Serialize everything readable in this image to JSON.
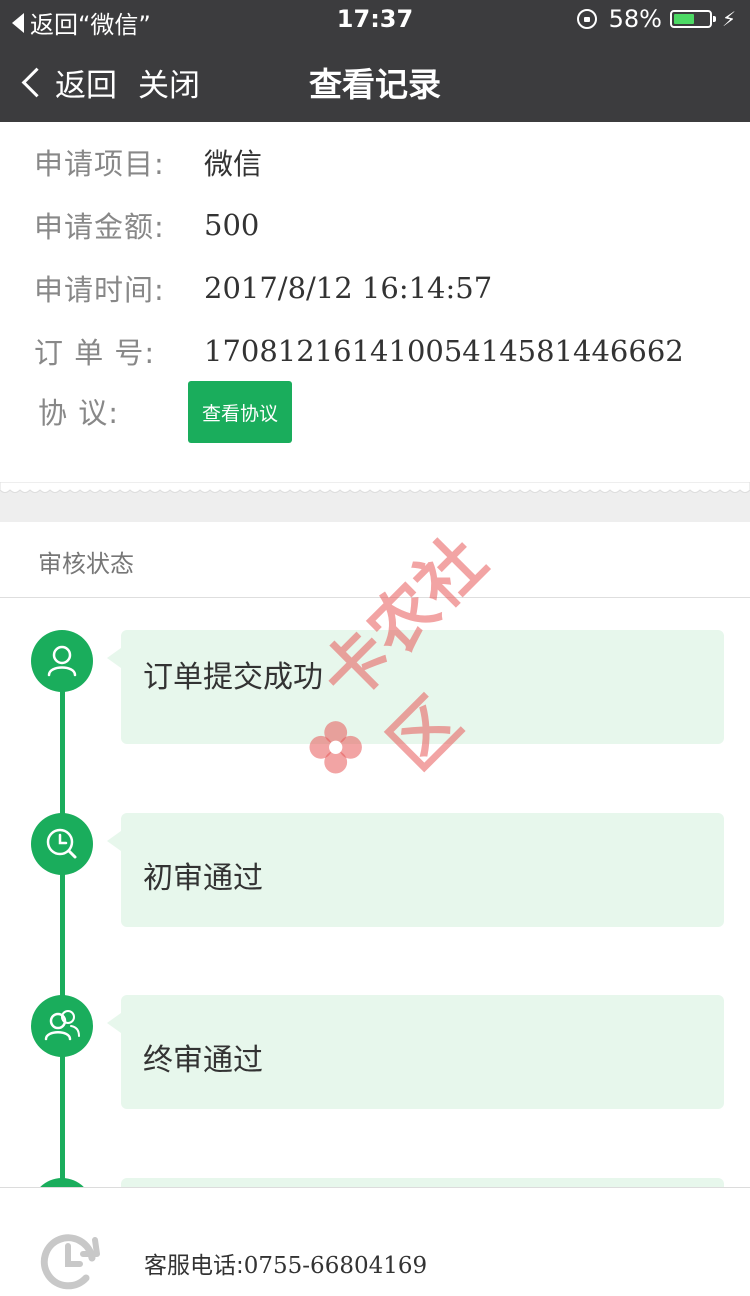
{
  "status_bar": {
    "back_app_label": "返回“微信”",
    "time": "17:37",
    "battery_percent_text": "58%",
    "battery_level": 0.58
  },
  "nav": {
    "back_label": "返回",
    "close_label": "关闭",
    "title": "查看记录"
  },
  "info": {
    "project_label": "申请项目:",
    "project_value": "微信",
    "amount_label": "申请金额:",
    "amount_value": "500",
    "time_label": "申请时间:",
    "time_value": "2017/8/12 16:14:57",
    "order_label": "订 单 号:",
    "order_value": "17081216141005414581446662",
    "agreement_label": "协  议:",
    "agreement_button": "查看协议"
  },
  "status_section": {
    "title": "审核状态",
    "steps": [
      {
        "label": "订单提交成功",
        "icon": "user-icon"
      },
      {
        "label": "初审通过",
        "icon": "clock-search-icon"
      },
      {
        "label": "终审通过",
        "icon": "group-users-icon"
      }
    ]
  },
  "footer": {
    "phone_label": "客服电话:",
    "phone_number": "0755-66804169"
  },
  "watermark": {
    "text": "卡农社区"
  },
  "colors": {
    "header_bg": "#3c3c3e",
    "accent_green": "#1aad5c",
    "card_bg": "#e7f7ec",
    "watermark": "#e85a5a"
  }
}
